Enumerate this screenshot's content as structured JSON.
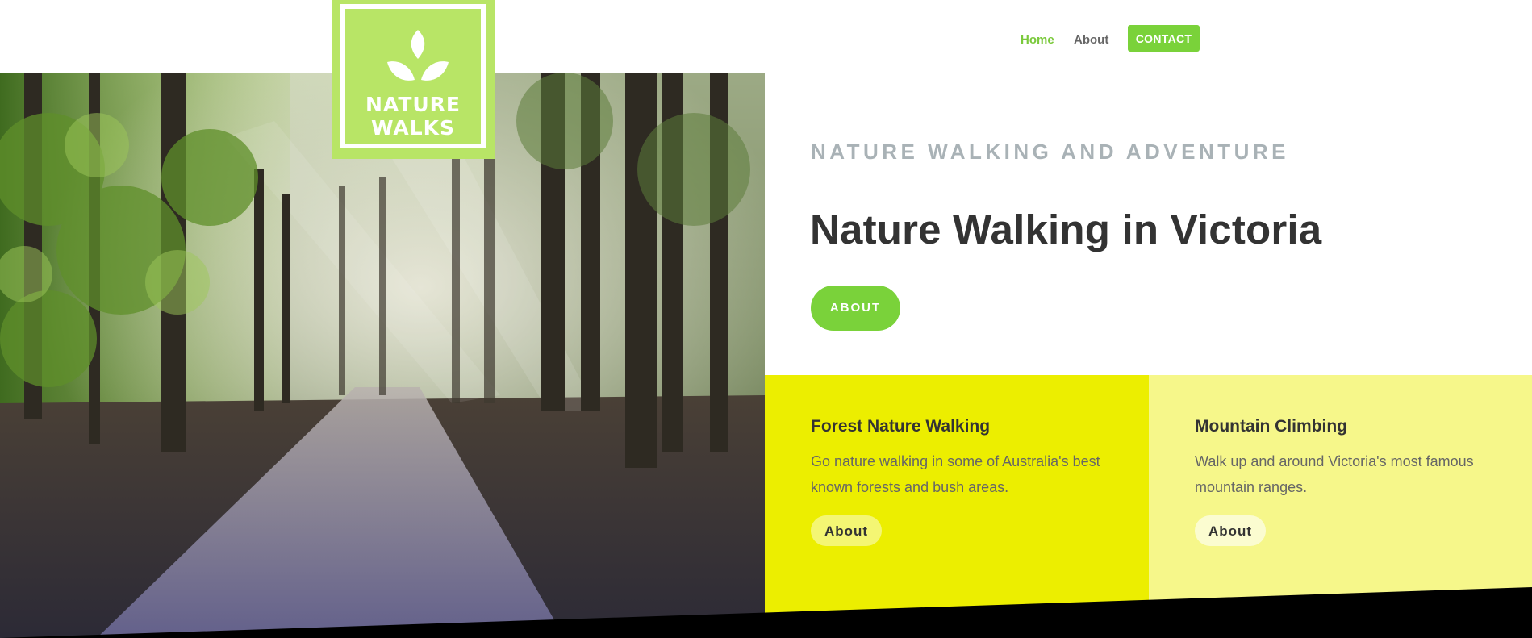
{
  "logo": {
    "line1": "NATURE",
    "line2": "WALKS",
    "color": "#b8e566"
  },
  "nav": {
    "home": "Home",
    "about": "About",
    "contact": "CONTACT",
    "active_color": "#7ac93b",
    "button_color": "#7ad23a"
  },
  "hero": {
    "eyebrow": "NATURE WALKING AND ADVENTURE",
    "title": "Nature Walking in Victoria",
    "button": "ABOUT",
    "image": "forest-path-sunbeams"
  },
  "cards": [
    {
      "title": "Forest Nature Walking",
      "text": "Go nature walking in some of Australia's best known forests and bush areas.",
      "button": "About",
      "color": "#ecee00"
    },
    {
      "title": "Mountain Climbing",
      "text": "Walk up and around Victoria's most famous mountain ranges.",
      "button": "About",
      "color": "#f6f78a"
    }
  ]
}
